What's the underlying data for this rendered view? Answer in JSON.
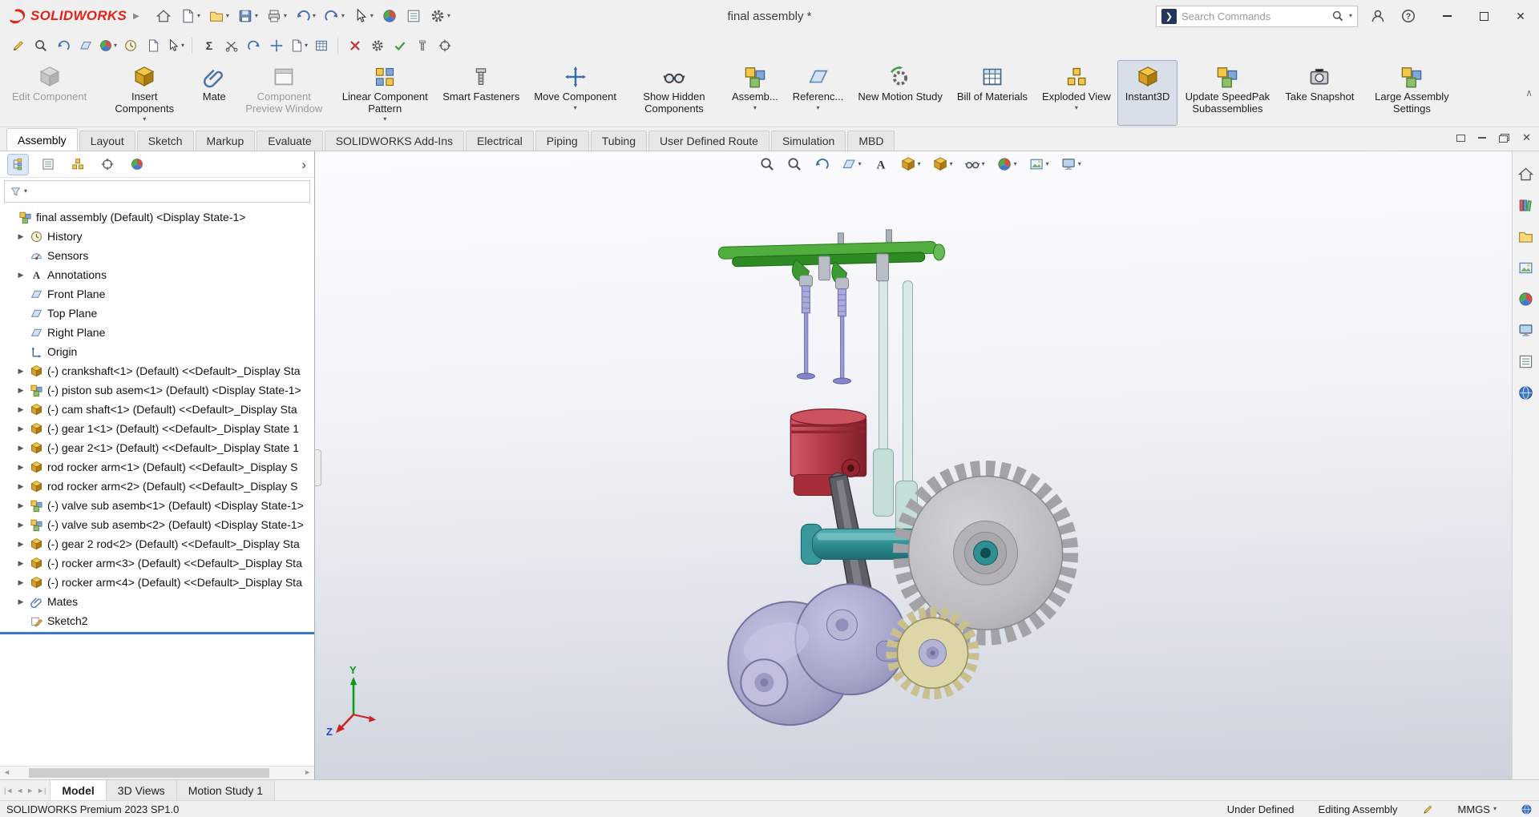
{
  "titlebar": {
    "logo_text": "SOLIDWORKS",
    "title": "final assembly *",
    "search_placeholder": "Search Commands",
    "quick_access_icons": [
      "home-icon",
      "new-document-icon",
      "open-document-icon",
      "save-icon",
      "print-icon",
      "undo-icon",
      "redo-icon",
      "select-cursor-icon",
      "rebuild-icon",
      "options-gear-icon"
    ],
    "window_controls": [
      "user-account-icon",
      "help-icon",
      "minimize-icon",
      "maximize-icon",
      "close-icon"
    ]
  },
  "toolbar2": {
    "icons": [
      "edit-sketch-icon",
      "zoom-icon",
      "rotate-view-icon",
      "reference-plane-icon",
      "appearance-icon",
      "history-icon",
      "document-icon",
      "select-filter-icon",
      "equations-icon",
      "trim-icon",
      "mirror-icon",
      "align-icon",
      "copy-icon",
      "design-table-icon",
      "delete-icon",
      "settings-gear-icon",
      "check-icon",
      "fastener-icon",
      "measure-icon",
      "record-icon"
    ]
  },
  "ribbon": {
    "buttons": [
      {
        "label": "Edit Component",
        "state": "disabled"
      },
      {
        "label": "Insert Components",
        "dropdown": true
      },
      {
        "label": "Mate"
      },
      {
        "label": "Component Preview Window",
        "state": "disabled"
      },
      {
        "label": "Linear Component Pattern",
        "dropdown": true
      },
      {
        "label": "Smart Fasteners"
      },
      {
        "label": "Move Component",
        "dropdown": true
      },
      {
        "label": "Show Hidden Components"
      },
      {
        "label": "Assemb...",
        "dropdown": true
      },
      {
        "label": "Referenc...",
        "dropdown": true
      },
      {
        "label": "New Motion Study"
      },
      {
        "label": "Bill of Materials"
      },
      {
        "label": "Exploded View",
        "dropdown": true
      },
      {
        "label": "Instant3D",
        "state": "active"
      },
      {
        "label": "Update SpeedPak Subassemblies"
      },
      {
        "label": "Take Snapshot"
      },
      {
        "label": "Large Assembly Settings"
      }
    ]
  },
  "command_tabs": {
    "active": "Assembly",
    "items": [
      "Assembly",
      "Layout",
      "Sketch",
      "Markup",
      "Evaluate",
      "SOLIDWORKS Add-Ins",
      "Electrical",
      "Piping",
      "Tubing",
      "User Defined Route",
      "Simulation",
      "MBD"
    ]
  },
  "feature_tree": {
    "root": "final assembly (Default) <Display State-1>",
    "items": [
      {
        "label": "History",
        "icon": "history-icon"
      },
      {
        "label": "Sensors",
        "icon": "sensors-icon"
      },
      {
        "label": "Annotations",
        "icon": "annotations-icon"
      },
      {
        "label": "Front Plane",
        "icon": "plane-icon"
      },
      {
        "label": "Top Plane",
        "icon": "plane-icon"
      },
      {
        "label": "Right Plane",
        "icon": "plane-icon"
      },
      {
        "label": "Origin",
        "icon": "origin-icon"
      },
      {
        "label": "(-) crankshaft<1> (Default) <<Default>_Display Sta",
        "icon": "part-icon"
      },
      {
        "label": "(-) piston sub asem<1> (Default) <Display State-1>",
        "icon": "subassembly-icon"
      },
      {
        "label": "(-) cam shaft<1> (Default) <<Default>_Display Sta",
        "icon": "part-icon"
      },
      {
        "label": "(-) gear 1<1> (Default) <<Default>_Display State 1",
        "icon": "part-icon"
      },
      {
        "label": "(-) gear 2<1> (Default) <<Default>_Display State 1",
        "icon": "part-icon"
      },
      {
        "label": "rod rocker arm<1> (Default) <<Default>_Display S",
        "icon": "part-icon"
      },
      {
        "label": "rod rocker arm<2> (Default) <<Default>_Display S",
        "icon": "part-icon"
      },
      {
        "label": "(-) valve sub asemb<1> (Default) <Display State-1>",
        "icon": "subassembly-icon"
      },
      {
        "label": "(-) valve sub asemb<2> (Default) <Display State-1>",
        "icon": "subassembly-icon"
      },
      {
        "label": "(-) gear 2 rod<2> (Default) <<Default>_Display Sta",
        "icon": "part-icon"
      },
      {
        "label": "(-) rocker arm<3> (Default) <<Default>_Display Sta",
        "icon": "part-icon"
      },
      {
        "label": "(-) rocker arm<4> (Default) <<Default>_Display Sta",
        "icon": "part-icon"
      },
      {
        "label": "Mates",
        "icon": "mates-icon"
      },
      {
        "label": "Sketch2",
        "icon": "sketch-icon"
      }
    ]
  },
  "viewport": {
    "hud_icons": [
      "zoom-fit-icon",
      "zoom-area-icon",
      "previous-view-icon",
      "section-view-icon",
      "annotation-visibility-icon",
      "view-orientation-icon",
      "display-style-icon",
      "hide-show-items-icon",
      "edit-appearance-icon",
      "apply-scene-icon",
      "view-settings-icon"
    ],
    "triad": {
      "y_label": "Y",
      "z_label": "Z"
    },
    "model_colors": {
      "crankshaft": "#a7a7cc",
      "piston": "#b23644",
      "camshaft": "#2f8f93",
      "rocker_shaft": "#3a9c2e",
      "valves": "#9898d2",
      "push_rods": "#d8e9e6",
      "gear_large": "#bcbcc0",
      "gear_small": "#ddd6a6"
    }
  },
  "task_pane": {
    "icons": [
      "home-icon",
      "design-library-icon",
      "file-explorer-icon",
      "view-palette-icon",
      "appearances-icon",
      "scenes-icon",
      "custom-properties-icon",
      "3dexperience-icon"
    ]
  },
  "bottom_tabs": {
    "active": "Model",
    "items": [
      "Model",
      "3D Views",
      "Motion Study 1"
    ]
  },
  "status_bar": {
    "product": "SOLIDWORKS Premium 2023 SP1.0",
    "constraint_status": "Under Defined",
    "mode": "Editing Assembly",
    "units": "MMGS"
  },
  "colors": {
    "accent": "#2a7ac6",
    "logo_red": "#e2231a",
    "rollback_bar": "#3c78c8"
  }
}
